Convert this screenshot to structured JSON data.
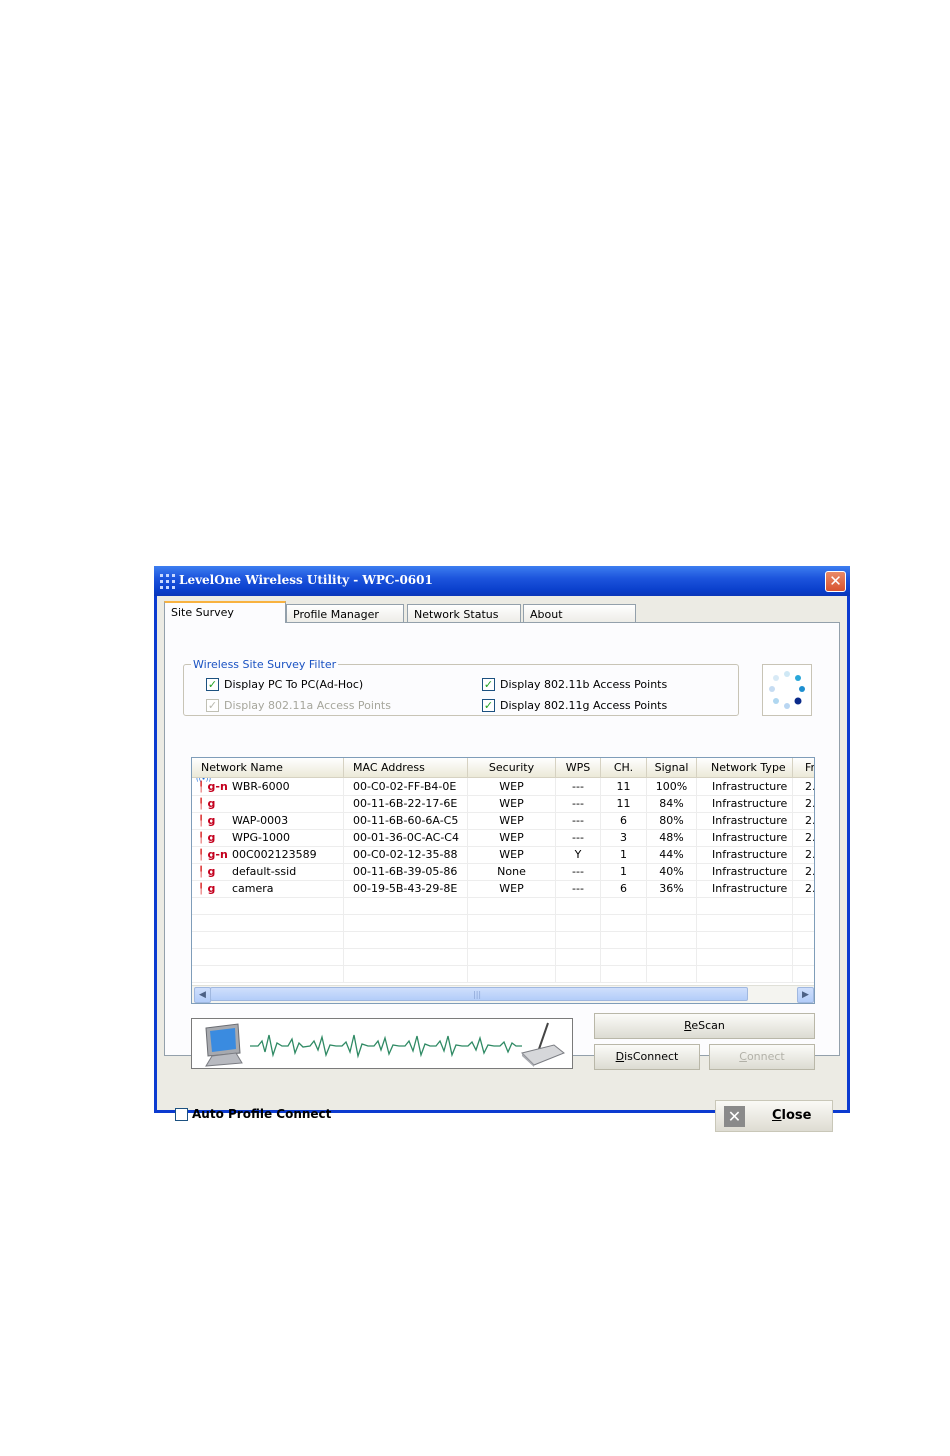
{
  "window": {
    "title": "LevelOne Wireless Utility - WPC-0601",
    "close_glyph": "✕"
  },
  "tabs": [
    {
      "label": "Site Survey"
    },
    {
      "label": "Profile Manager"
    },
    {
      "label": "Network Status"
    },
    {
      "label": "About"
    }
  ],
  "filter": {
    "legend": "Wireless Site Survey Filter",
    "adhoc": {
      "label": "Display PC To PC(Ad-Hoc)",
      "checked": true
    },
    "b": {
      "label": "Display 802.11b Access Points",
      "checked": true
    },
    "a": {
      "label": "Display 802.11a Access Points",
      "checked": true,
      "disabled": true
    },
    "g": {
      "label": "Display 802.11g Access Points",
      "checked": true
    }
  },
  "table": {
    "headers": [
      "Network Name",
      "MAC Address",
      "Security",
      "WPS",
      "CH.",
      "Signal",
      "Network Type",
      "Fr"
    ],
    "rows": [
      {
        "band": "g-n",
        "connected": true,
        "name": "WBR-6000",
        "mac": "00-C0-02-FF-B4-0E",
        "security": "WEP",
        "wps": "---",
        "ch": "11",
        "signal": "100%",
        "type": "Infrastructure",
        "fr": "2."
      },
      {
        "band": "g",
        "connected": false,
        "name": "",
        "mac": "00-11-6B-22-17-6E",
        "security": "WEP",
        "wps": "---",
        "ch": "11",
        "signal": "84%",
        "type": "Infrastructure",
        "fr": "2."
      },
      {
        "band": "g",
        "connected": false,
        "name": "WAP-0003",
        "mac": "00-11-6B-60-6A-C5",
        "security": "WEP",
        "wps": "---",
        "ch": "6",
        "signal": "80%",
        "type": "Infrastructure",
        "fr": "2."
      },
      {
        "band": "g",
        "connected": false,
        "name": "WPG-1000",
        "mac": "00-01-36-0C-AC-C4",
        "security": "WEP",
        "wps": "---",
        "ch": "3",
        "signal": "48%",
        "type": "Infrastructure",
        "fr": "2."
      },
      {
        "band": "g-n",
        "connected": false,
        "name": "00C002123589",
        "mac": "00-C0-02-12-35-88",
        "security": "WEP",
        "wps": "Y",
        "ch": "1",
        "signal": "44%",
        "type": "Infrastructure",
        "fr": "2."
      },
      {
        "band": "g",
        "connected": false,
        "name": "default-ssid",
        "mac": "00-11-6B-39-05-86",
        "security": "None",
        "wps": "---",
        "ch": "1",
        "signal": "40%",
        "type": "Infrastructure",
        "fr": "2."
      },
      {
        "band": "g",
        "connected": false,
        "name": "camera",
        "mac": "00-19-5B-43-29-8E",
        "security": "WEP",
        "wps": "---",
        "ch": "6",
        "signal": "36%",
        "type": "Infrastructure",
        "fr": "2."
      }
    ],
    "empty_rows": 5,
    "scroll_grip": "|||"
  },
  "buttons": {
    "rescan": "ReScan",
    "disconnect": "DisConnect",
    "connect": "Connect",
    "close": "Close"
  },
  "auto_profile_connect": {
    "label": "Auto Profile Connect",
    "checked": false
  },
  "colors": {
    "titlebar": "#0c3bd0",
    "accent_tab": "#f8b240",
    "legend_blue": "#1a52c2",
    "band_red": "#c4001e"
  }
}
